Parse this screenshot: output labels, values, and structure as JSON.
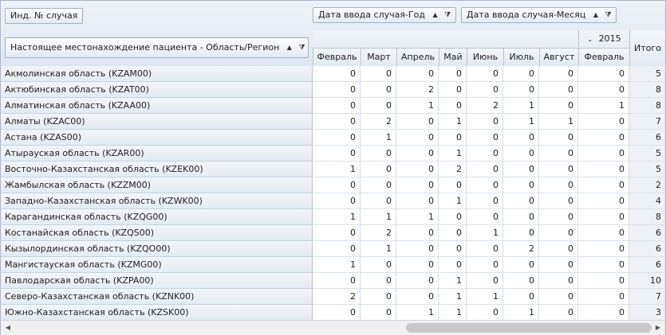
{
  "fields": {
    "data_field": "Инд. № случая",
    "col_field_year": "Дата ввода случая-Год",
    "col_field_month": "Дата ввода случая-Месяц",
    "row_field": "Настоящее местонахождение пациента - Область/Регион"
  },
  "icons": {
    "sort_asc": "▲",
    "filter": "⧩",
    "collapse": "⌄",
    "scroll_left": "◀",
    "scroll_right": "▶"
  },
  "year_label": "2015",
  "total_header": "Итого",
  "months": [
    "Февраль",
    "Март",
    "Апрель",
    "Май",
    "Июнь",
    "Июль",
    "Август",
    "Февраль"
  ],
  "rows": [
    {
      "label": "Акмолинская область (KZAM00)",
      "values": [
        "0",
        "0",
        "0",
        "0",
        "0",
        "0",
        "0",
        "0"
      ],
      "total": "5"
    },
    {
      "label": "Актюбинская область (KZAT00)",
      "values": [
        "0",
        "0",
        "2",
        "0",
        "0",
        "0",
        "0",
        "0"
      ],
      "total": "8"
    },
    {
      "label": "Алматинская область (KZAA00)",
      "values": [
        "0",
        "0",
        "1",
        "0",
        "2",
        "1",
        "0",
        "1"
      ],
      "total": "8"
    },
    {
      "label": "Алматы (KZAC00)",
      "values": [
        "0",
        "2",
        "0",
        "1",
        "0",
        "1",
        "1",
        "0"
      ],
      "total": "7"
    },
    {
      "label": "Астана (KZAS00)",
      "values": [
        "0",
        "1",
        "0",
        "0",
        "0",
        "0",
        "0",
        "0"
      ],
      "total": "6"
    },
    {
      "label": "Атырауская область (KZAR00)",
      "values": [
        "0",
        "0",
        "0",
        "1",
        "0",
        "0",
        "0",
        "0"
      ],
      "total": "5"
    },
    {
      "label": "Восточно-Казахстанская область (KZEK00)",
      "values": [
        "1",
        "0",
        "0",
        "2",
        "0",
        "0",
        "0",
        "0"
      ],
      "total": "5"
    },
    {
      "label": "Жамбылская область (KZZM00)",
      "values": [
        "0",
        "0",
        "0",
        "0",
        "0",
        "0",
        "0",
        "0"
      ],
      "total": "2"
    },
    {
      "label": "Западно-Казахстанская область (KZWK00)",
      "values": [
        "0",
        "0",
        "0",
        "1",
        "0",
        "0",
        "0",
        "0"
      ],
      "total": "4"
    },
    {
      "label": "Карагандинская область (KZQG00)",
      "values": [
        "1",
        "1",
        "1",
        "0",
        "0",
        "0",
        "0",
        "0"
      ],
      "total": "8"
    },
    {
      "label": "Костанайская область (KZQS00)",
      "values": [
        "0",
        "2",
        "0",
        "0",
        "1",
        "0",
        "0",
        "0"
      ],
      "total": "6"
    },
    {
      "label": "Кызылординская область (KZQO00)",
      "values": [
        "0",
        "1",
        "0",
        "0",
        "0",
        "2",
        "0",
        "0"
      ],
      "total": "6"
    },
    {
      "label": "Мангистауская область (KZMG00)",
      "values": [
        "1",
        "0",
        "0",
        "0",
        "0",
        "0",
        "0",
        "0"
      ],
      "total": "6"
    },
    {
      "label": "Павлодарская область (KZPA00)",
      "values": [
        "0",
        "0",
        "0",
        "1",
        "0",
        "0",
        "0",
        "0"
      ],
      "total": "10"
    },
    {
      "label": "Северо-Казахстанская область (KZNK00)",
      "values": [
        "2",
        "0",
        "0",
        "1",
        "1",
        "0",
        "0",
        "0"
      ],
      "total": "7"
    },
    {
      "label": "Южно-Казахстанская область (KZSK00)",
      "values": [
        "0",
        "0",
        "1",
        "1",
        "0",
        "1",
        "0",
        "0"
      ],
      "total": "3"
    }
  ]
}
